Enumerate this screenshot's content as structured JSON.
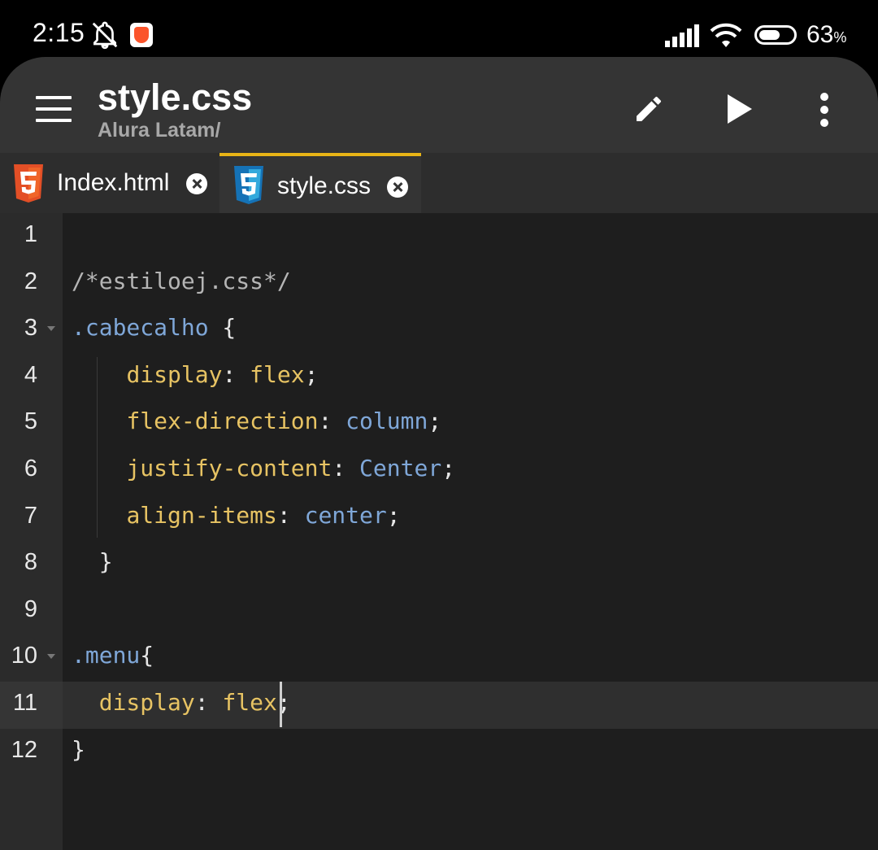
{
  "status_bar": {
    "time": "2:15",
    "battery_level": 0.63,
    "battery_percent": "63",
    "battery_unit": "%",
    "icons": [
      "notifications-muted-icon",
      "brave-browser-icon",
      "signal-icon",
      "wifi-icon",
      "battery-icon"
    ]
  },
  "app_bar": {
    "title": "style.css",
    "subtitle": "Alura Latam/",
    "icons": [
      "menu-icon",
      "pencil-icon",
      "play-icon",
      "more-vert-icon"
    ]
  },
  "tabs": [
    {
      "label": "Index.html",
      "icon": "html5-icon",
      "active": false
    },
    {
      "label": "style.css",
      "icon": "css3-icon",
      "active": true
    }
  ],
  "editor": {
    "current_line": "11",
    "lines": [
      {
        "num": "1",
        "foldable": false,
        "tokens": []
      },
      {
        "num": "2",
        "foldable": false,
        "tokens": [
          {
            "t": "comment",
            "v": "/*estiloej.css*/"
          }
        ]
      },
      {
        "num": "3",
        "foldable": true,
        "tokens": [
          {
            "t": "sel",
            "v": ".cabecalho"
          },
          {
            "t": "punc",
            "v": " {"
          }
        ]
      },
      {
        "num": "4",
        "foldable": false,
        "tokens": [
          {
            "t": "punc",
            "v": "    "
          },
          {
            "t": "prop",
            "v": "display"
          },
          {
            "t": "punc",
            "v": ": "
          },
          {
            "t": "val",
            "v": "flex"
          },
          {
            "t": "punc",
            "v": ";"
          }
        ]
      },
      {
        "num": "5",
        "foldable": false,
        "tokens": [
          {
            "t": "punc",
            "v": "    "
          },
          {
            "t": "prop",
            "v": "flex-direction"
          },
          {
            "t": "punc",
            "v": ": "
          },
          {
            "t": "kw",
            "v": "column"
          },
          {
            "t": "punc",
            "v": ";"
          }
        ]
      },
      {
        "num": "6",
        "foldable": false,
        "tokens": [
          {
            "t": "punc",
            "v": "    "
          },
          {
            "t": "prop",
            "v": "justify-content"
          },
          {
            "t": "punc",
            "v": ": "
          },
          {
            "t": "kw",
            "v": "Center"
          },
          {
            "t": "punc",
            "v": ";"
          }
        ]
      },
      {
        "num": "7",
        "foldable": false,
        "tokens": [
          {
            "t": "punc",
            "v": "    "
          },
          {
            "t": "prop",
            "v": "align-items"
          },
          {
            "t": "punc",
            "v": ": "
          },
          {
            "t": "kw",
            "v": "center"
          },
          {
            "t": "punc",
            "v": ";"
          }
        ]
      },
      {
        "num": "8",
        "foldable": false,
        "tokens": [
          {
            "t": "punc",
            "v": "  }"
          }
        ]
      },
      {
        "num": "9",
        "foldable": false,
        "tokens": []
      },
      {
        "num": "10",
        "foldable": true,
        "tokens": [
          {
            "t": "sel",
            "v": ".menu"
          },
          {
            "t": "punc",
            "v": "{"
          }
        ]
      },
      {
        "num": "11",
        "foldable": false,
        "tokens": [
          {
            "t": "punc",
            "v": "  "
          },
          {
            "t": "prop",
            "v": "display"
          },
          {
            "t": "punc",
            "v": ": "
          },
          {
            "t": "val",
            "v": "flex"
          },
          {
            "t": "punc",
            "v": ";"
          }
        ]
      },
      {
        "num": "12",
        "foldable": false,
        "tokens": [
          {
            "t": "punc",
            "v": "}"
          }
        ]
      }
    ]
  },
  "colors": {
    "accent": "#e8b416",
    "app_bar": "#343434",
    "editor_bg": "#1e1e1e",
    "selector": "#7fa7d8",
    "property": "#e7c363",
    "comment": "#b5b5b5"
  }
}
